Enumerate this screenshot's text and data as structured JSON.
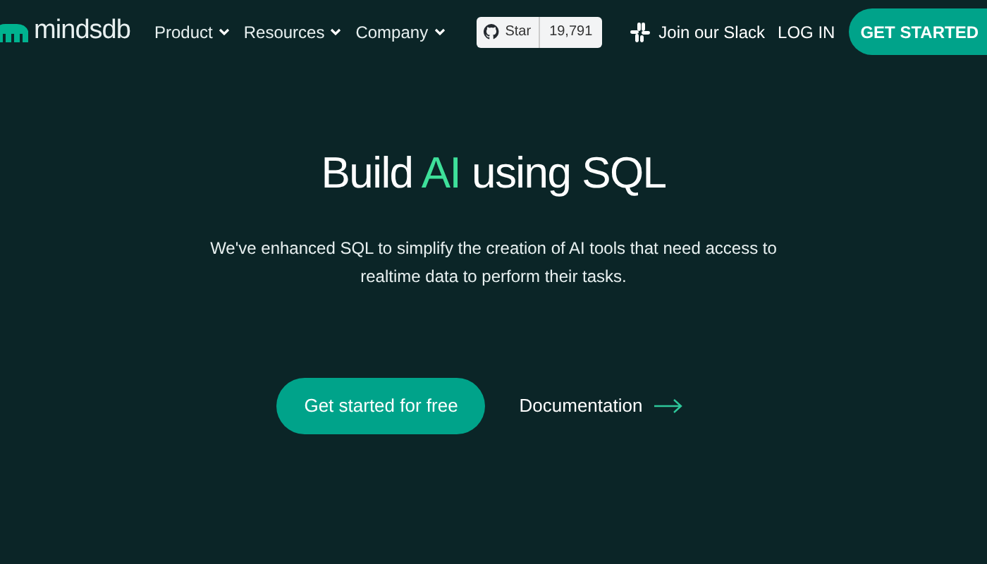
{
  "nav": {
    "logo": "mindsdb",
    "menus": [
      {
        "label": "Product"
      },
      {
        "label": "Resources"
      },
      {
        "label": "Company"
      }
    ],
    "github": {
      "label": "Star",
      "count": "19,791"
    },
    "slack": "Join our Slack",
    "login": "LOG IN",
    "cta": "GET STARTED"
  },
  "hero": {
    "headline": [
      {
        "text": "Build ",
        "highlight": false
      },
      {
        "text": "AI",
        "highlight": true
      },
      {
        "text": " using SQL",
        "highlight": false
      }
    ],
    "subtitle": "We've enhanced SQL to simplify the creation of AI tools that need access to realtime data to perform their tasks.",
    "primary_button": "Get started for free",
    "secondary_link": "Documentation"
  }
}
